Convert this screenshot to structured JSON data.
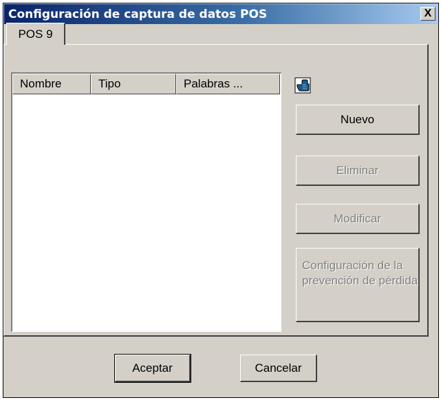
{
  "window": {
    "title": "Configuración de captura de datos POS",
    "close_label": "X"
  },
  "tab": {
    "label": "POS 9"
  },
  "list": {
    "columns": [
      "Nombre",
      "Tipo",
      "Palabras ..."
    ],
    "rows": []
  },
  "side_buttons": {
    "new": "Nuevo",
    "delete": "Eliminar",
    "modify": "Modificar",
    "loss_prevention": "Configuración de la prevención de pérdida"
  },
  "footer": {
    "ok": "Aceptar",
    "cancel": "Cancelar"
  },
  "icons": {
    "pointer": "pointing-hand-icon"
  },
  "colors": {
    "titlebar_start": "#0a246a",
    "titlebar_end": "#a6caf0",
    "face": "#d4d0c8",
    "disabled_text": "#808080"
  }
}
